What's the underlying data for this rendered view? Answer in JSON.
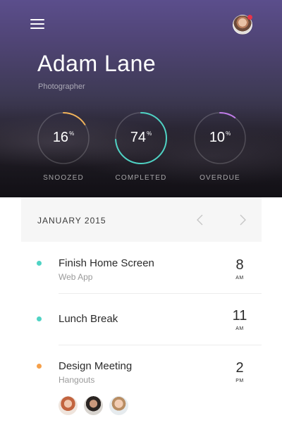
{
  "profile": {
    "name": "Adam Lane",
    "role": "Photographer",
    "avatar_icon": "user-avatar",
    "notification_color": "#e8344a"
  },
  "menu": {
    "icon": "hamburger-menu-icon"
  },
  "stats": [
    {
      "value": "16",
      "unit": "%",
      "label": "SNOOZED",
      "fraction": 0.16,
      "color": "#f0b25a"
    },
    {
      "value": "74",
      "unit": "%",
      "label": "COMPLETED",
      "fraction": 0.74,
      "color": "#4fd3c4"
    },
    {
      "value": "10",
      "unit": "%",
      "label": "OVERDUE",
      "fraction": 0.1,
      "color": "#c07ce8"
    }
  ],
  "calendar": {
    "month": "JANUARY 2015",
    "prev_icon": "chevron-left-icon",
    "next_icon": "chevron-right-icon"
  },
  "events": [
    {
      "title": "Finish Home Screen",
      "subtitle": "Web App",
      "time": "8",
      "ampm": "AM",
      "color": "#4fd3c4"
    },
    {
      "title": "Lunch Break",
      "subtitle": "",
      "time": "11",
      "ampm": "AM",
      "color": "#4fd3c4"
    },
    {
      "title": "Design Meeting",
      "subtitle": "Hangouts",
      "time": "2",
      "ampm": "PM",
      "color": "#f5a04a"
    }
  ],
  "attendees": [
    "attendee-avatar",
    "attendee-avatar",
    "attendee-avatar"
  ]
}
